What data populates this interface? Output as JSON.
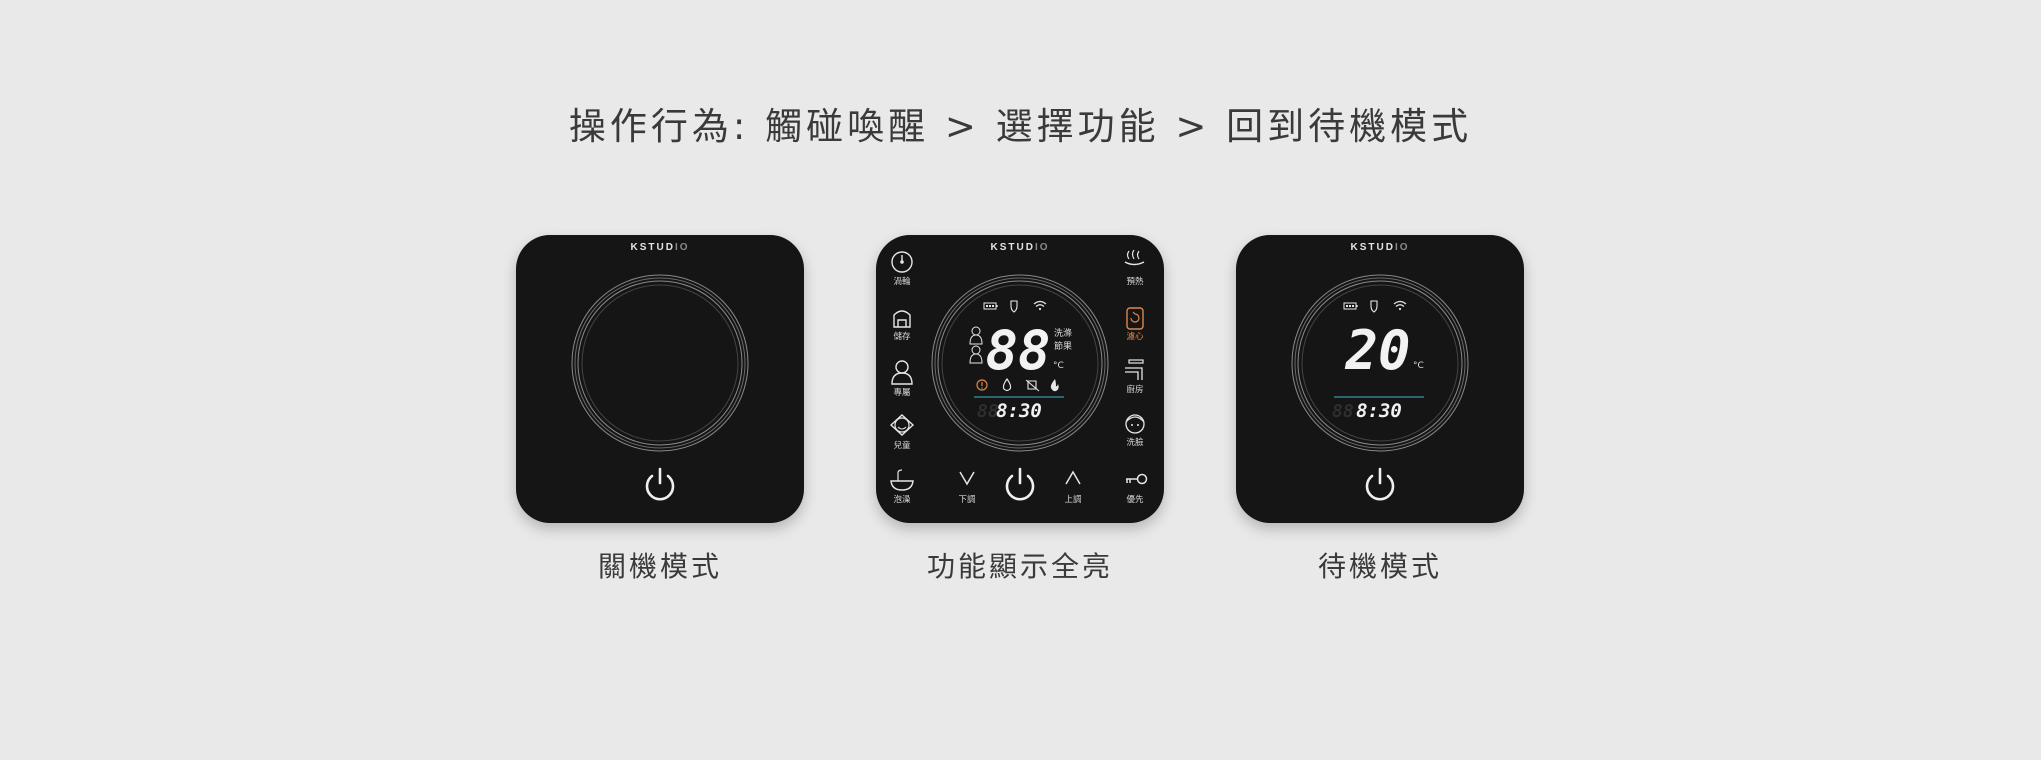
{
  "header": {
    "title": "操作行為: 觸碰喚醒 > 選擇功能 > 回到待機模式"
  },
  "brand": {
    "main": "KSTUD",
    "fade": "IO"
  },
  "panels": [
    {
      "caption": "關機模式"
    },
    {
      "caption": "功能顯示全亮",
      "left_buttons": [
        "渦輪",
        "儲存",
        "專屬",
        "兒童",
        "泡澡"
      ],
      "right_buttons": [
        "預熱",
        "濾心",
        "廚房",
        "洗臉",
        "優先"
      ],
      "bottom_controls": {
        "down": "下調",
        "up": "上調"
      },
      "display": {
        "temperature": "88",
        "unit": "°C",
        "time": "8:30",
        "status_line1": "洗滌",
        "status_line2": "節果"
      }
    },
    {
      "caption": "待機模式",
      "display": {
        "temperature": "20",
        "unit": "°C",
        "time": "8:30"
      }
    }
  ],
  "colors": {
    "accent_orange": "#e0874a",
    "accent_cyan": "#3fb6c6",
    "panel": "#151515",
    "background": "#e9e9e9"
  },
  "icons": [
    "battery-icon",
    "shield-icon",
    "wifi-icon",
    "power-icon",
    "key-icon",
    "faucet-icon",
    "filter-icon",
    "bath-icon"
  ]
}
